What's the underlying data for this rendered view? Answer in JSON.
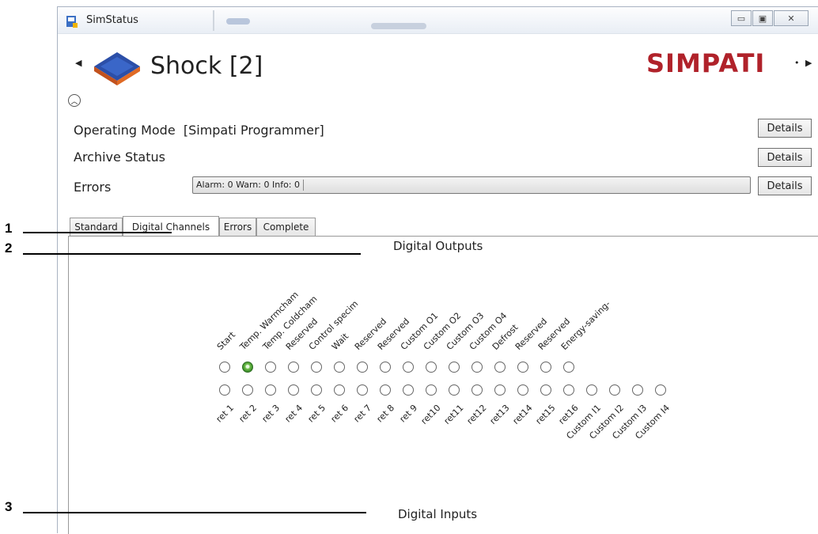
{
  "window": {
    "title": "SimStatus"
  },
  "header": {
    "title": "Shock [2]",
    "logo_text": "SIMPATI",
    "logo_mark": "•"
  },
  "rows": {
    "operating_mode_label": "Operating Mode",
    "operating_mode_value": "[Simpati Programmer]",
    "archive_label": "Archive Status",
    "errors_label": "Errors",
    "errors_summary": "Alarm: 0  Warn: 0  Info: 0",
    "details_label": "Details"
  },
  "tabs": [
    {
      "label": "Standard",
      "active": false
    },
    {
      "label": "Digital Channels",
      "active": true
    },
    {
      "label": "Errors",
      "active": false
    },
    {
      "label": "Complete",
      "active": false
    }
  ],
  "digital_outputs": {
    "title": "Digital Outputs",
    "labels": [
      "Start",
      "Temp. Warmcham",
      "Temp. Coldcham",
      "Reserved",
      "Control specim",
      "Wait",
      "Reserved",
      "Reserved",
      "Custom O1",
      "Custom O2",
      "Custom O3",
      "Custom O4",
      "Defrost",
      "Reserved",
      "Reserved",
      "Energy-saving-"
    ],
    "states": [
      false,
      true,
      false,
      false,
      false,
      false,
      false,
      false,
      false,
      false,
      false,
      false,
      false,
      false,
      false,
      false
    ]
  },
  "returns": {
    "labels": [
      "ret 1",
      "ret 2",
      "ret 3",
      "ret 4",
      "ret 5",
      "ret 6",
      "ret 7",
      "ret 8",
      "ret 9",
      "ret10",
      "ret11",
      "ret12",
      "ret13",
      "ret14",
      "ret15",
      "ret16",
      "Custom I1",
      "Custom I2",
      "Custom I3",
      "Custom I4"
    ],
    "states": [
      false,
      false,
      false,
      false,
      false,
      false,
      false,
      false,
      false,
      false,
      false,
      false,
      false,
      false,
      false,
      false,
      false,
      false,
      false,
      false
    ]
  },
  "digital_inputs": {
    "title": "Digital Inputs"
  },
  "annotations": [
    "1",
    "2",
    "3"
  ]
}
